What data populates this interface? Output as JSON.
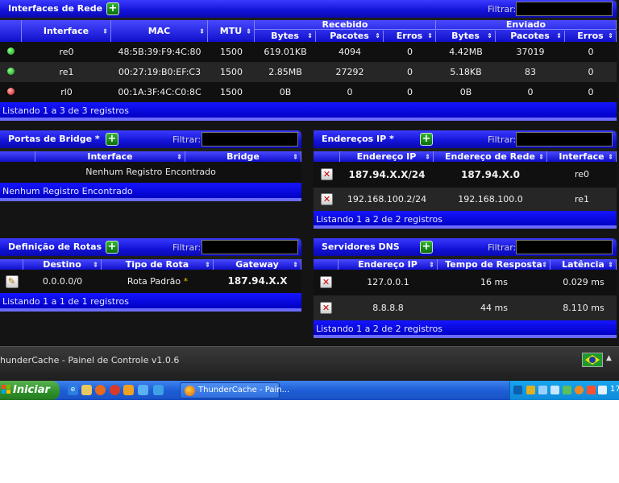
{
  "interfaces": {
    "title": "Interfaces de Rede",
    "filter_label": "Filtrar:",
    "columns": [
      "Interface",
      "MAC",
      "MTU"
    ],
    "received_label": "Recebido",
    "sent_label": "Enviado",
    "sub_columns": [
      "Bytes",
      "Pacotes",
      "Erros",
      "Bytes",
      "Pacotes",
      "Erros"
    ],
    "rows": [
      {
        "status": "up",
        "iface": "re0",
        "mac": "48:5B:39:F9:4C:80",
        "mtu": "1500",
        "rx_bytes": "619.01KB",
        "rx_pkts": "4094",
        "rx_err": "0",
        "tx_bytes": "4.42MB",
        "tx_pkts": "37019",
        "tx_err": "0"
      },
      {
        "status": "up",
        "iface": "re1",
        "mac": "00:27:19:B0:EF:C3",
        "mtu": "1500",
        "rx_bytes": "2.85MB",
        "rx_pkts": "27292",
        "rx_err": "0",
        "tx_bytes": "5.18KB",
        "tx_pkts": "83",
        "tx_err": "0"
      },
      {
        "status": "down",
        "iface": "rl0",
        "mac": "00:1A:3F:4C:C0:8C",
        "mtu": "1500",
        "rx_bytes": "0B",
        "rx_pkts": "0",
        "rx_err": "0",
        "tx_bytes": "0B",
        "tx_pkts": "0",
        "tx_err": "0"
      }
    ],
    "footer": "Listando 1 a 3 de 3 registros"
  },
  "bridge": {
    "title": "Portas de Bridge *",
    "filter_label": "Filtrar:",
    "columns": [
      "Interface",
      "Bridge"
    ],
    "empty": "Nenhum Registro Encontrado",
    "footer": "Nenhum Registro Encontrado"
  },
  "ip": {
    "title": "Endereços IP *",
    "filter_label": "Filtrar:",
    "columns": [
      "Endereço IP",
      "Endereço de Rede",
      "Interface"
    ],
    "rows": [
      {
        "addr": "187.94.X.X/24",
        "net": "187.94.X.0",
        "iface": "re0"
      },
      {
        "addr": "192.168.100.2/24",
        "net": "192.168.100.0",
        "iface": "re1"
      }
    ],
    "footer": "Listando 1 a 2 de 2 registros"
  },
  "routes": {
    "title": "Definição de Rotas",
    "filter_label": "Filtrar:",
    "columns": [
      "Destino",
      "Tipo de Rota",
      "Gateway"
    ],
    "rows": [
      {
        "dest": "0.0.0.0/0",
        "type": "Rota Padrão",
        "mark": "*",
        "gw": "187.94.X.X"
      }
    ],
    "footer": "Listando 1 a 1 de 1 registros"
  },
  "dns": {
    "title": "Servidores DNS",
    "filter_label": "Filtrar:",
    "columns": [
      "Endereço IP",
      "Tempo de Resposta",
      "Latência"
    ],
    "rows": [
      {
        "addr": "127.0.0.1",
        "resp": "16 ms",
        "lat": "0.029 ms"
      },
      {
        "addr": "8.8.8.8",
        "resp": "44 ms",
        "lat": "8.110 ms"
      }
    ],
    "footer": "Listando 1 a 2 de 2 registros"
  },
  "statusbar": {
    "text": "hunderCache - Painel de Controle v1.0.6"
  },
  "taskbar": {
    "start_label": "Iniciar",
    "window_title": "ThunderCache - Pain...",
    "clock": "17:"
  },
  "colors": {
    "header_blue": "#1212d8",
    "add_green": "#0b6e0b",
    "status_up": "#0a9a0a",
    "status_down": "#d01010"
  }
}
